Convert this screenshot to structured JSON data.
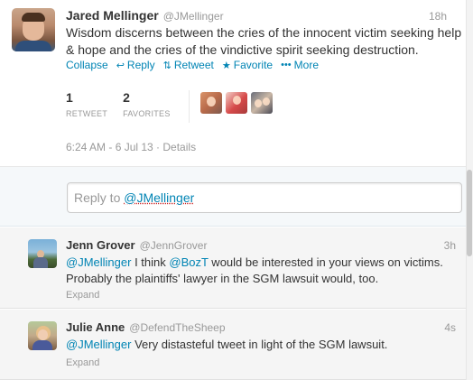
{
  "main_tweet": {
    "fullname": "Jared Mellinger",
    "username": "@JMellinger",
    "time": "18h",
    "text": "Wisdom discerns between the cries of the innocent victim seeking help & hope and the cries of the vindictive spirit seeking destruction.",
    "actions": {
      "collapse": "Collapse",
      "reply": "Reply",
      "retweet": "Retweet",
      "favorite": "Favorite",
      "more": "More"
    },
    "stats": {
      "retweet_count": "1",
      "retweet_label": "RETWEET",
      "favorites_count": "2",
      "favorites_label": "FAVORITES"
    },
    "timestamp": "6:24 AM - 6 Jul 13 · Details"
  },
  "reply_box": {
    "prefix": "Reply to ",
    "mention": "@JMellinger"
  },
  "replies": [
    {
      "fullname": "Jenn Grover",
      "username": "@JennGrover",
      "time": "3h",
      "mention1": "@JMellinger",
      "text1": " I think ",
      "mention2": "@BozT",
      "text2": " would be interested in your views on victims. Probably the plaintiffs' lawyer in the SGM lawsuit would, too.",
      "expand": "Expand"
    },
    {
      "fullname": "Julie Anne",
      "username": "@DefendTheSheep",
      "time": "4s",
      "mention1": "@JMellinger",
      "text1": " Very distasteful tweet in light of the SGM lawsuit.",
      "expand": "Expand"
    }
  ],
  "icons": {
    "reply": "reply-arrow",
    "retweet": "retweet-arrows",
    "favorite": "star",
    "more": "three-dots"
  },
  "colors": {
    "link": "#0084b4",
    "muted": "#999999",
    "text": "#333333"
  }
}
